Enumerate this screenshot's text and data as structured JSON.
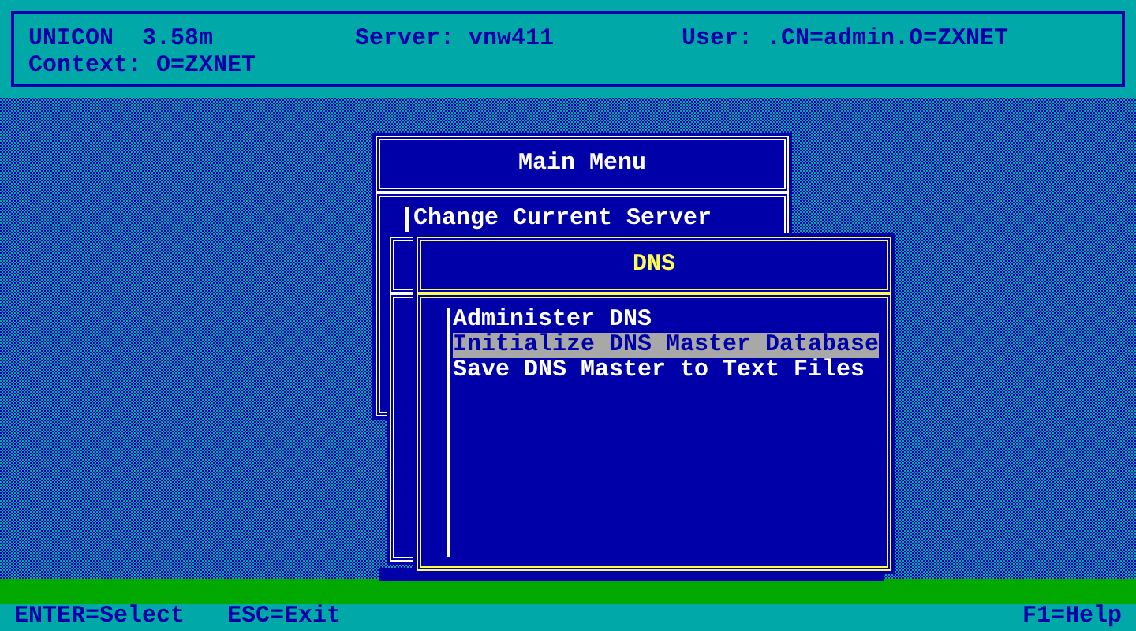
{
  "header": {
    "product": "UNICON",
    "version": "3.58m",
    "server": "Server: vnw411",
    "user": "User: .CN=admin.O=ZXNET",
    "context": "Context: O=ZXNET"
  },
  "main_menu": {
    "title": "Main Menu",
    "items": [
      {
        "label": "Change Current Server"
      }
    ]
  },
  "dns_menu": {
    "title": "DNS",
    "items": [
      {
        "label": "Administer DNS",
        "selected": false
      },
      {
        "label": "Initialize DNS Master Database",
        "selected": true
      },
      {
        "label": "Save DNS Master to Text Files",
        "selected": false
      }
    ]
  },
  "footer": {
    "left_keys": [
      "ENTER=Select",
      "ESC=Exit"
    ],
    "right_keys": [
      "F1=Help"
    ]
  }
}
